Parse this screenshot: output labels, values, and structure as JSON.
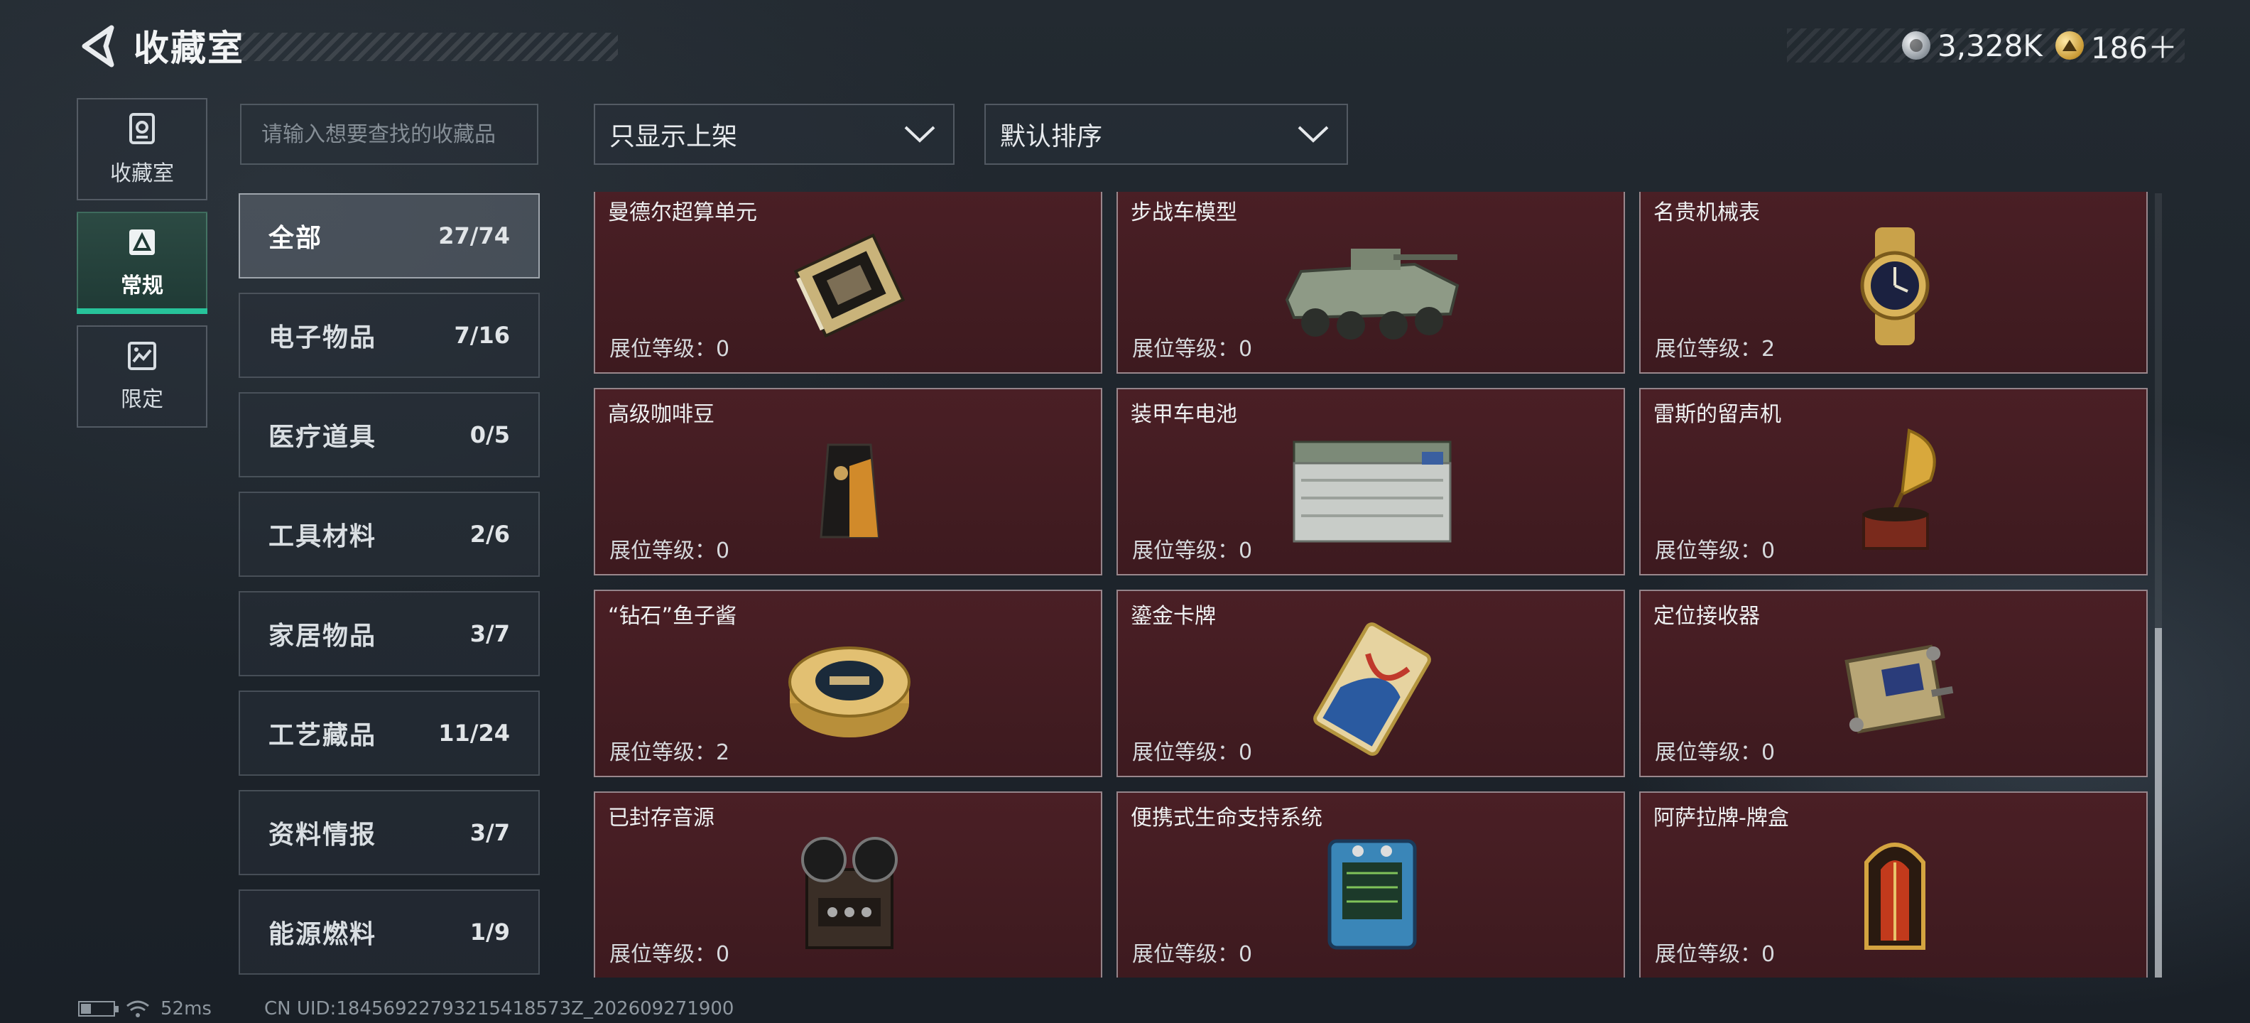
{
  "header": {
    "title": "收藏室"
  },
  "currency": {
    "silver": "3,328K",
    "gold": "186＋"
  },
  "side_nav": [
    {
      "label": "收藏室",
      "icon": "collection-icon",
      "active": false
    },
    {
      "label": "常规",
      "icon": "regular-icon",
      "active": true
    },
    {
      "label": "限定",
      "icon": "limited-icon",
      "active": false
    }
  ],
  "search": {
    "placeholder": "请输入想要查找的收藏品",
    "value": ""
  },
  "filters": {
    "shelf_filter": "只显示上架",
    "sort": "默认排序"
  },
  "categories": [
    {
      "name": "全部",
      "count": "27/74",
      "active": true
    },
    {
      "name": "电子物品",
      "count": "7/16"
    },
    {
      "name": "医疗道具",
      "count": "0/5"
    },
    {
      "name": "工具材料",
      "count": "2/6"
    },
    {
      "name": "家居物品",
      "count": "3/7"
    },
    {
      "name": "工艺藏品",
      "count": "11/24"
    },
    {
      "name": "资料情报",
      "count": "3/7"
    },
    {
      "name": "能源燃料",
      "count": "1/9"
    }
  ],
  "level_label": "展位等级：",
  "items": [
    {
      "name": "曼德尔超算单元",
      "level": "0",
      "icon": "supercomputer-unit-icon"
    },
    {
      "name": "步战车模型",
      "level": "0",
      "icon": "armored-vehicle-model-icon"
    },
    {
      "name": "名贵机械表",
      "level": "2",
      "icon": "mechanical-watch-icon"
    },
    {
      "name": "高级咖啡豆",
      "level": "0",
      "icon": "coffee-beans-icon"
    },
    {
      "name": "装甲车电池",
      "level": "0",
      "icon": "vehicle-battery-icon"
    },
    {
      "name": "雷斯的留声机",
      "level": "0",
      "icon": "gramophone-icon"
    },
    {
      "name": "“钻石”鱼子酱",
      "level": "2",
      "icon": "caviar-tin-icon"
    },
    {
      "name": "鎏金卡牌",
      "level": "0",
      "icon": "gilded-card-icon"
    },
    {
      "name": "定位接收器",
      "level": "0",
      "icon": "locator-receiver-icon"
    },
    {
      "name": "已封存音源",
      "level": "0",
      "icon": "reel-recorder-icon"
    },
    {
      "name": "便携式生命支持系统",
      "level": "0",
      "icon": "life-support-icon"
    },
    {
      "name": "阿萨拉牌-牌盒",
      "level": "0",
      "icon": "card-box-icon"
    }
  ],
  "status_bar": {
    "ping": "52ms",
    "uid": "CN UID:18456922793215418573Z_202609271900"
  },
  "colors": {
    "accent": "#27c39a",
    "card_bg": "#441c22"
  }
}
